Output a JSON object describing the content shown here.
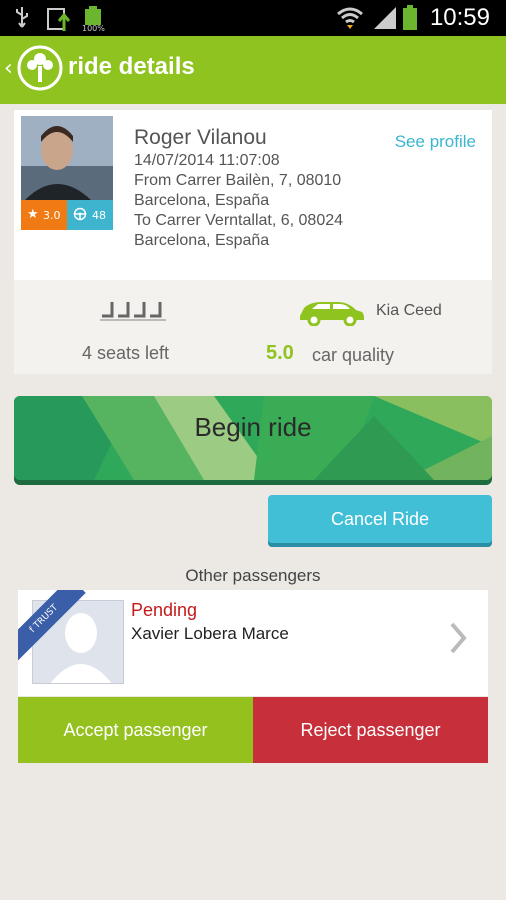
{
  "status_bar": {
    "time": "10:59",
    "battery_small_label": "100%",
    "icons": [
      "usb-icon",
      "upload-icon",
      "battery-full-small-icon",
      "wifi-icon",
      "signal-icon",
      "battery-icon"
    ]
  },
  "header": {
    "title": "ride details",
    "back_icon": "chevron-left-icon",
    "logo_icon": "tree-logo-icon",
    "color": "#8fc31f"
  },
  "driver": {
    "name": "Roger Vilanou",
    "see_profile": "See profile",
    "rating": "3.0",
    "rides_count": "48",
    "date": "14/07/2014 11:07:08",
    "from_line1": "From Carrer Bailèn, 7, 08010",
    "from_line2": "Barcelona, España",
    "to_line1": "To Carrer Verntallat, 6, 08024",
    "to_line2": "Barcelona, España"
  },
  "vehicle": {
    "seats_left": "4 seats left",
    "car_model": "Kia Ceed",
    "car_quality_score": "5.0",
    "car_quality_label": "car quality"
  },
  "actions": {
    "begin_ride": "Begin ride",
    "cancel_ride": "Cancel Ride"
  },
  "passengers": {
    "section_title": "Other passengers",
    "items": [
      {
        "status": "Pending",
        "name": "Xavier Lobera Marce",
        "badge": "TRUST",
        "accept": "Accept passenger",
        "reject": "Reject passenger"
      }
    ]
  },
  "colors": {
    "green": "#8fc31f",
    "teal": "#40bfd7",
    "red": "#c7303a",
    "orange": "#f07a13"
  }
}
